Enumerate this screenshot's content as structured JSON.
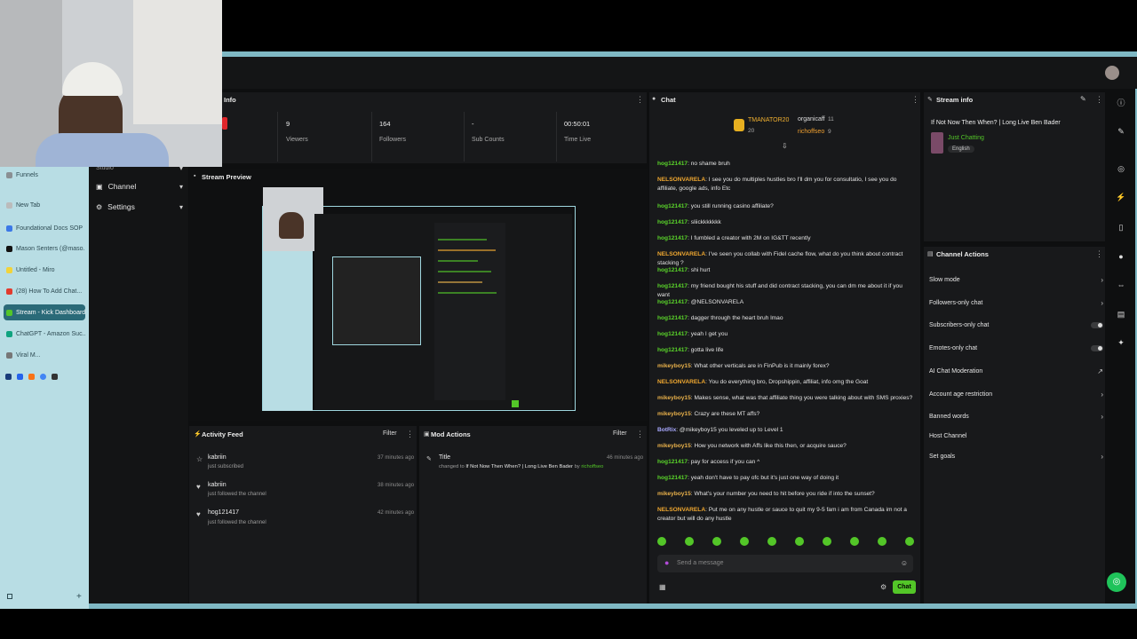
{
  "browser_tabs": [
    {
      "label": "Funnels",
      "color": "#8a8f93"
    },
    {
      "label": "New Tab",
      "color": "#bbbbbb"
    },
    {
      "label": "Foundational Docs SOP",
      "color": "#3b78e7"
    },
    {
      "label": "Mason Senters (@maso...",
      "color": "#111111"
    },
    {
      "label": "Untitled - Miro",
      "color": "#f2d33a"
    },
    {
      "label": "(28) How To Add Chat...",
      "color": "#e23b2e"
    },
    {
      "label": "Stream - Kick Dashboard",
      "color": "#53c628"
    },
    {
      "label": "ChatGPT - Amazon Suc...",
      "color": "#10a37f"
    },
    {
      "label": "Viral M...",
      "color": "#777777"
    }
  ],
  "nav": {
    "studio": "Studio",
    "channel": "Channel",
    "settings": "Settings"
  },
  "info_panel": {
    "title": "Info",
    "stats": [
      {
        "value": "9",
        "label": "Viewers"
      },
      {
        "value": "164",
        "label": "Followers"
      },
      {
        "value": "-",
        "label": "Sub Counts"
      },
      {
        "value": "00:50:01",
        "label": "Time Live"
      }
    ]
  },
  "stream_preview": {
    "title": "Stream Preview"
  },
  "activity_feed": {
    "title": "Activity Feed",
    "filter": "Filter",
    "items": [
      {
        "name": "kabriin",
        "action": "just subscribed",
        "time": "37 minutes ago",
        "icon": "star-icon"
      },
      {
        "name": "kabriin",
        "action": "just followed the channel",
        "time": "38 minutes ago",
        "icon": "heart-icon"
      },
      {
        "name": "hog121417",
        "action": "just followed the channel",
        "time": "42 minutes ago",
        "icon": "heart-icon"
      }
    ]
  },
  "mod_actions": {
    "title": "Mod Actions",
    "filter": "Filter",
    "item": {
      "heading": "Title",
      "prefix": "changed to",
      "new_title": "If Not Now Then When? | Long Live Ben Bader",
      "by": "by",
      "user": "richoffseo",
      "time": "46 minutes ago"
    }
  },
  "chat": {
    "title": "Chat",
    "leaderboard": [
      {
        "name": "TMANATOR20",
        "count": "20"
      },
      {
        "name": "organicaff",
        "count": "11"
      },
      {
        "name": "richoffseo",
        "count": "9"
      }
    ],
    "messages": [
      {
        "user": "hog121417",
        "color": "#5ad52a",
        "text": "no shame bruh"
      },
      {
        "user": "NELSONVARELA",
        "color": "#f0a830",
        "text": "I see you do multiples hustles bro I'll dm you for consultatio, I see you do affiliate, google ads, info Etc"
      },
      {
        "user": "hog121417",
        "color": "#5ad52a",
        "text": "you still running casino affiliate?"
      },
      {
        "user": "hog121417",
        "color": "#5ad52a",
        "text": "sliickkkkkkk"
      },
      {
        "user": "hog121417",
        "color": "#5ad52a",
        "text": "I fumbled a creator with 2M on IG&TT recently"
      },
      {
        "user": "NELSONVARELA",
        "color": "#f0a830",
        "text": "I've seen you collab with Fidel cache flow, what do you think about contract stacking ?"
      },
      {
        "user": "hog121417",
        "color": "#5ad52a",
        "text": "shi hurt"
      },
      {
        "user": "hog121417",
        "color": "#5ad52a",
        "text": "my friend bought his stuff and did contract stacking, you can dm me about it if you want"
      },
      {
        "user": "hog121417",
        "color": "#5ad52a",
        "text": "@NELSONVARELA"
      },
      {
        "user": "hog121417",
        "color": "#5ad52a",
        "text": "dagger through the heart bruh lmao"
      },
      {
        "user": "hog121417",
        "color": "#5ad52a",
        "text": "yeah I get you"
      },
      {
        "user": "hog121417",
        "color": "#5ad52a",
        "text": "gotta live life"
      },
      {
        "user": "mikeyboy15",
        "color": "#e8b04a",
        "text": "What other verticals are in FinPub is it mainly forex?"
      },
      {
        "user": "NELSONVARELA",
        "color": "#f0a830",
        "text": "You do everything bro, Dropshippin, affiliat, info omg the Goat"
      },
      {
        "user": "mikeyboy15",
        "color": "#e8b04a",
        "text": "Makes sense, what was that affiliate thing you were talking about with SMS proxies?"
      },
      {
        "user": "mikeyboy15",
        "color": "#e8b04a",
        "text": "Crazy are these MT affs?"
      },
      {
        "user": "BotRix",
        "color": "#a9a9ff",
        "text": "@mikeyboy15 you leveled up to Level 1"
      },
      {
        "user": "mikeyboy15",
        "color": "#e8b04a",
        "text": "How you network with Affs like this then, or acquire sauce?"
      },
      {
        "user": "hog121417",
        "color": "#5ad52a",
        "text": "pay for access if you can ^"
      },
      {
        "user": "hog121417",
        "color": "#5ad52a",
        "text": "yeah don't have to pay ofc but it's just one way of doing it"
      },
      {
        "user": "mikeyboy15",
        "color": "#e8b04a",
        "text": "What's your number you need to hit before you ride if into the sunset?"
      },
      {
        "user": "NELSONVARELA",
        "color": "#f0a830",
        "text": "Put me on any hustle or sauce to quit my 9-5 fam i am from Canada im not a creator but will do any hustle"
      }
    ],
    "input_placeholder": "Send a message",
    "send_button": "Chat"
  },
  "stream_info": {
    "title": "Stream info",
    "stream_title": "If Not Now Then When? | Long Live Ben Bader",
    "category": "Just Chatting",
    "language": "English"
  },
  "channel_actions": {
    "title": "Channel Actions",
    "items": [
      {
        "label": "Slow mode",
        "control": "chevron"
      },
      {
        "label": "Followers-only chat",
        "control": "chevron"
      },
      {
        "label": "Subscribers-only chat",
        "control": "toggle"
      },
      {
        "label": "Emotes-only chat",
        "control": "toggle"
      },
      {
        "label": "AI Chat Moderation",
        "control": "external"
      },
      {
        "label": "Account age restriction",
        "control": "chevron"
      },
      {
        "label": "Banned words",
        "control": "chevron"
      },
      {
        "label": "Host Channel",
        "control": "none"
      },
      {
        "label": "Set goals",
        "control": "chevron"
      }
    ]
  },
  "colors": {
    "accent_green": "#53c628",
    "panel_bg": "#18191b",
    "frame": "#7fb8c4"
  }
}
